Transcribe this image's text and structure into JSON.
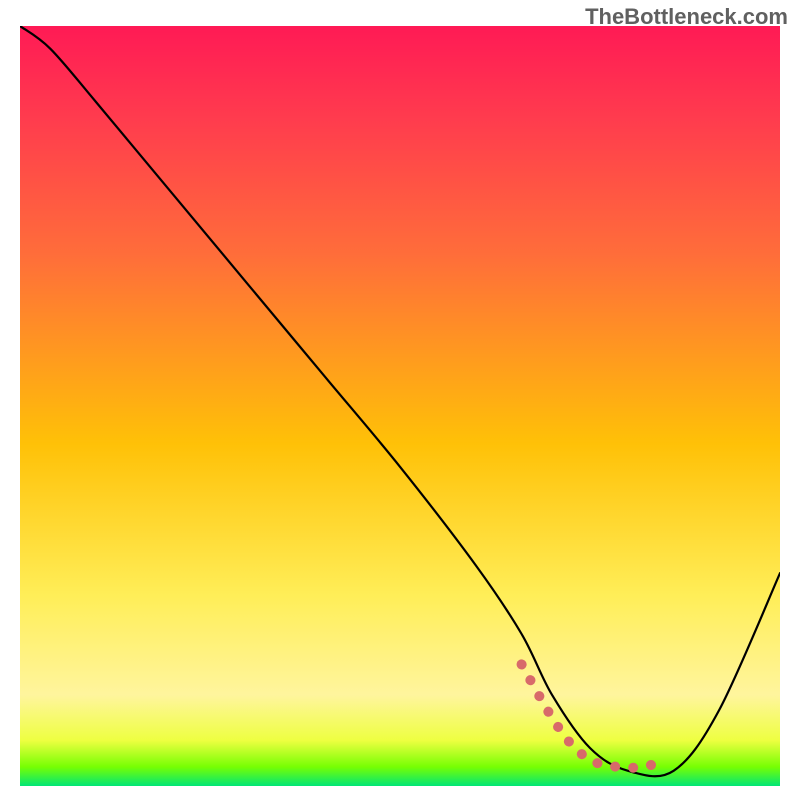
{
  "watermark": "TheBottleneck.com",
  "chart_data": {
    "type": "line",
    "title": "",
    "xlabel": "",
    "ylabel": "",
    "ylim": [
      0,
      100
    ],
    "xlim": [
      0,
      100
    ],
    "grid": false,
    "legend": false,
    "gradient": {
      "top_color": "#ff1744",
      "mid_upper_color": "#ff6d3a",
      "mid_color": "#ffd740",
      "mid_lower_color": "#fff176",
      "near_bottom_color": "#f4ff81",
      "bottom_color": "#00e676",
      "stops": [
        {
          "offset": 0.0,
          "color": "#ff1a55"
        },
        {
          "offset": 0.12,
          "color": "#ff3b4e"
        },
        {
          "offset": 0.3,
          "color": "#ff6d3a"
        },
        {
          "offset": 0.55,
          "color": "#ffc107"
        },
        {
          "offset": 0.75,
          "color": "#ffee58"
        },
        {
          "offset": 0.88,
          "color": "#fff59d"
        },
        {
          "offset": 0.94,
          "color": "#eeff41"
        },
        {
          "offset": 0.975,
          "color": "#76ff03"
        },
        {
          "offset": 1.0,
          "color": "#00e676"
        }
      ]
    },
    "series": [
      {
        "name": "bottleneck-curve",
        "stroke": "#000000",
        "stroke_width": 2.2,
        "x": [
          0,
          4,
          10,
          20,
          30,
          40,
          50,
          60,
          66,
          70,
          75,
          80,
          86,
          92,
          100
        ],
        "values": [
          100,
          97,
          90,
          78,
          66,
          54,
          42,
          29,
          20,
          12,
          5,
          2,
          2,
          10,
          28
        ]
      },
      {
        "name": "sweet-spot-band",
        "stroke": "#d86a6a",
        "stroke_width": 10,
        "dash": "0.1 18",
        "linecap": "round",
        "x": [
          66,
          70,
          73,
          76,
          79,
          82,
          85
        ],
        "values": [
          16,
          9,
          5,
          3,
          2.5,
          2.5,
          3.5
        ]
      }
    ],
    "annotations": []
  }
}
